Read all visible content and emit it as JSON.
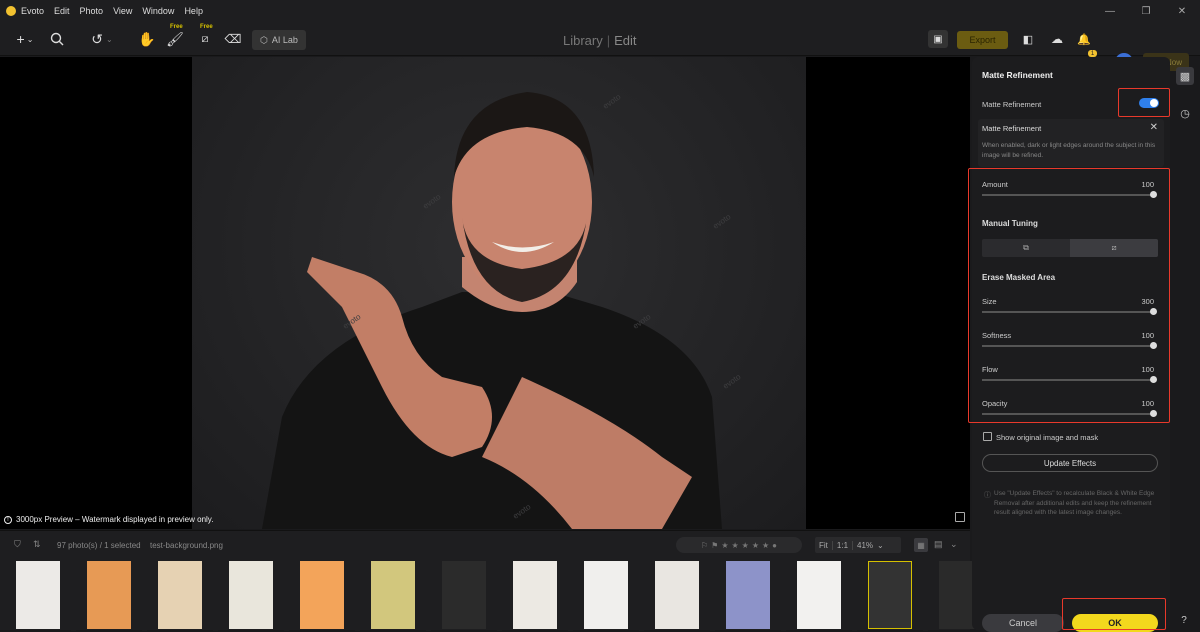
{
  "app": {
    "name": "Evoto"
  },
  "menu": {
    "items": [
      "Edit",
      "Photo",
      "View",
      "Window",
      "Help"
    ]
  },
  "toolbar": {
    "free_label": "Free",
    "ai_lab": "AI Lab",
    "modes": {
      "library": "Library",
      "edit": "Edit"
    },
    "export": "Export",
    "notification_count": "1",
    "user_initial": "H",
    "buy_now": "Buy Now"
  },
  "canvas": {
    "watermark": "evoto",
    "preview_note": "3000px Preview – Watermark displayed in preview only."
  },
  "filmstrip": {
    "count": "97 photo(s) / 1 selected",
    "filename": "test-background.png",
    "fit": "Fit",
    "one_to_one": "1:1",
    "zoom": "41%",
    "thumbs": [
      {
        "color": "#eceae7"
      },
      {
        "color": "#e79a55"
      },
      {
        "color": "#e6d2b3"
      },
      {
        "color": "#e9e6dc"
      },
      {
        "color": "#f3a45a"
      },
      {
        "color": "#d2c77d"
      },
      {
        "color": "#2b2b2b"
      },
      {
        "color": "#ece9e3"
      },
      {
        "color": "#f0efed"
      },
      {
        "color": "#e9e6e1"
      },
      {
        "color": "#8d93c9"
      },
      {
        "color": "#f2f1ef"
      },
      {
        "color": "#333333",
        "selected": true
      },
      {
        "color": "#2a2a2a"
      }
    ]
  },
  "panel": {
    "title": "Matte Refinement",
    "toggle_label": "Matte Refinement",
    "popup_title": "Matte Refinement",
    "popup_desc": "When enabled, dark or light edges around the subject in this image will be refined.",
    "amount_label": "Amount",
    "amount_value": "100",
    "manual_tuning": "Manual Tuning",
    "erase_title": "Erase Masked Area",
    "size_label": "Size",
    "size_value": "300",
    "softness_label": "Softness",
    "softness_value": "100",
    "flow_label": "Flow",
    "flow_value": "100",
    "opacity_label": "Opacity",
    "opacity_value": "100",
    "show_original": "Show original image and mask",
    "update_effects": "Update Effects",
    "note": "Use \"Update Effects\" to recalculate Black & White Edge Removal after additional edits and keep the refinement result aligned with the latest image changes.",
    "cancel": "Cancel",
    "ok": "OK"
  }
}
